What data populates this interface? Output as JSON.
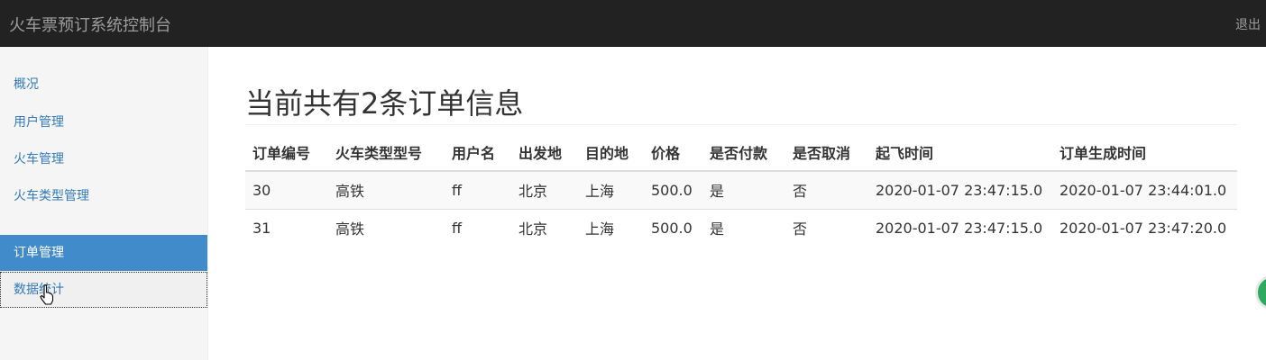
{
  "header": {
    "brand": "火车票预订系统控制台",
    "logout_label": "退出"
  },
  "sidebar": {
    "items": [
      {
        "label": "概况"
      },
      {
        "label": "用户管理"
      },
      {
        "label": "火车管理"
      },
      {
        "label": "火车类型管理"
      },
      {
        "label": "订单管理",
        "active": true
      },
      {
        "label": "数据统计"
      }
    ]
  },
  "main": {
    "title": "当前共有2条订单信息",
    "table": {
      "headers": [
        "订单编号",
        "火车类型型号",
        "用户名",
        "出发地",
        "目的地",
        "价格",
        "是否付款",
        "是否取消",
        "起飞时间",
        "订单生成时间"
      ],
      "rows": [
        [
          "30",
          "高铁",
          "ff",
          "北京",
          "上海",
          "500.0",
          "是",
          "否",
          "2020-01-07 23:47:15.0",
          "2020-01-07 23:44:01.0"
        ],
        [
          "31",
          "高铁",
          "ff",
          "北京",
          "上海",
          "500.0",
          "是",
          "否",
          "2020-01-07 23:47:15.0",
          "2020-01-07 23:47:20.0"
        ]
      ]
    }
  },
  "colors": {
    "navbar": "#222222",
    "active_item": "#428bca",
    "link": "#337ab7"
  }
}
